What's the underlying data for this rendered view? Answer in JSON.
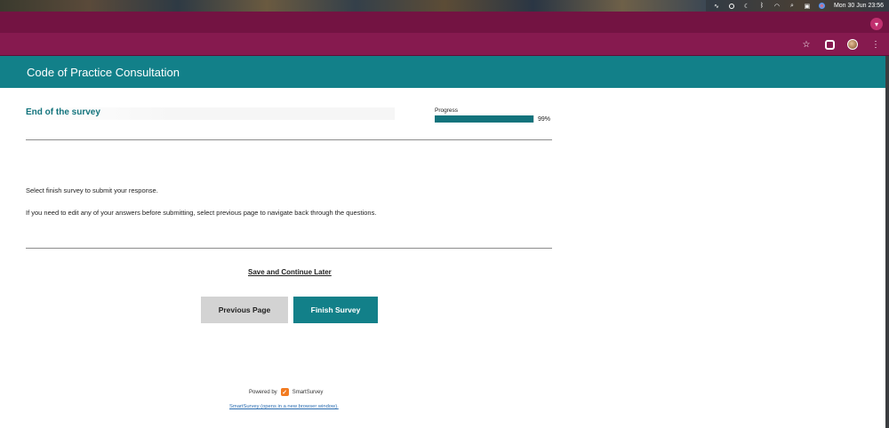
{
  "menubar": {
    "datetime": "Mon 30 Jun  23:56",
    "icons": [
      "activity-icon",
      "account-circle-icon",
      "moon-icon",
      "bluetooth-icon",
      "wifi-icon",
      "search-icon",
      "control-center-icon",
      "siri-icon"
    ]
  },
  "browser": {
    "toolbar_icons": [
      "star-icon",
      "extensions-icon",
      "profile-avatar",
      "more-menu-icon"
    ]
  },
  "survey": {
    "header_title": "Code of Practice Consultation",
    "section_title": "End of the survey",
    "progress": {
      "label": "Progress",
      "value_text": "99%",
      "value": 0.99
    },
    "paragraphs": [
      "Select finish survey to submit your response.",
      "If you need to edit any of your answers before submitting, select previous page to navigate back through the questions."
    ],
    "save_link": "Save and Continue Later",
    "buttons": {
      "previous": "Previous Page",
      "finish": "Finish Survey"
    },
    "footer": {
      "powered_by": "Powered by",
      "brand": "SmartSurvey",
      "link": "SmartSurvey (opens in a new browser window)."
    }
  },
  "colors": {
    "teal": "#128089",
    "browser_frame": "#7d1748"
  }
}
